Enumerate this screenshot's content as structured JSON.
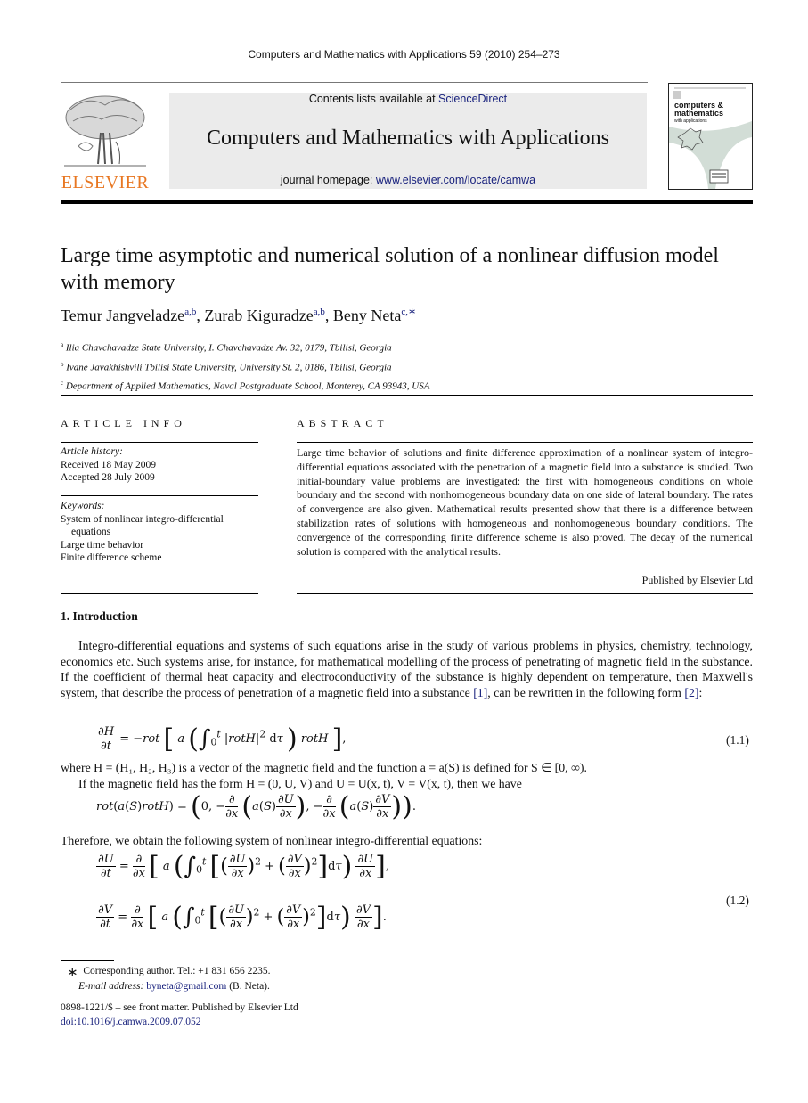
{
  "running_head": "Computers and Mathematics with Applications 59 (2010) 254–273",
  "masthead": {
    "publisher": "ELSEVIER",
    "contents_prefix": "Contents lists available at ",
    "contents_link": "ScienceDirect",
    "journal_title": "Computers and Mathematics with Applications",
    "homepage_prefix": "journal homepage: ",
    "homepage_link": "www.elsevier.com/locate/camwa",
    "cover_title_line1": "computers &",
    "cover_title_line2": "mathematics",
    "cover_subtitle": "with applications",
    "colors": {
      "publisher_orange": "#e87722",
      "link_blue": "#1a237e",
      "masthead_gray": "#ebebeb"
    }
  },
  "paper": {
    "title": "Large time asymptotic and numerical solution of a nonlinear diffusion model with memory",
    "authors": [
      {
        "name": "Temur Jangveladze",
        "marks": "a,b"
      },
      {
        "name": "Zurab Kiguradze",
        "marks": "a,b"
      },
      {
        "name": "Beny Neta",
        "marks": "c,∗"
      }
    ],
    "affiliations": [
      {
        "mark": "a",
        "text": "Ilia Chavchavadze State University, I. Chavchavadze Av. 32, 0179, Tbilisi, Georgia"
      },
      {
        "mark": "b",
        "text": "Ivane Javakhishvili Tbilisi State University, University St. 2, 0186, Tbilisi, Georgia"
      },
      {
        "mark": "c",
        "text": "Department of Applied Mathematics, Naval Postgraduate School, Monterey, CA 93943, USA"
      }
    ]
  },
  "article_info": {
    "heading": "ARTICLE INFO",
    "history_label": "Article history:",
    "received": "Received 18 May 2009",
    "accepted": "Accepted 28 July 2009",
    "keywords_label": "Keywords:",
    "keywords": [
      "System of nonlinear integro-differential",
      "equations",
      "Large time behavior",
      "Finite difference scheme"
    ]
  },
  "abstract": {
    "heading": "ABSTRACT",
    "text": "Large time behavior of solutions and finite difference approximation of a nonlinear system of integro-differential equations associated with the penetration of a magnetic field into a substance is studied. Two initial-boundary value problems are investigated: the first with homogeneous conditions on whole boundary and the second with nonhomogeneous boundary data on one side of lateral boundary. The rates of convergence are also given. Mathematical results presented show that there is a difference between stabilization rates of solutions with homogeneous and nonhomogeneous boundary conditions. The convergence of the corresponding finite difference scheme is also proved. The decay of the numerical solution is compared with the analytical results.",
    "published_by": "Published by Elsevier Ltd"
  },
  "introduction": {
    "heading": "1.  Introduction",
    "para1_before_ref1": "Integro-differential equations and systems of such equations arise in the study of various problems in physics, chemistry, technology, economics etc. Such systems arise, for instance, for mathematical modelling of the process of penetrating of magnetic field in the substance. If the coefficient of thermal heat capacity and electroconductivity of the substance is highly dependent on temperature, then Maxwell's system, that describe the process of penetration of a magnetic field into a substance ",
    "ref1": "[1]",
    "para1_between": ", can be rewritten in the following form ",
    "ref2": "[2]",
    "para1_end": ":",
    "eq11_number": "(1.1)",
    "where_line": "where H = (H₁, H₂, H₃) is a vector of the magnetic field and the function a = a(S) is defined for S ∈ [0, ∞).",
    "if_line": "If the magnetic field has the form H = (0, U, V) and U = U(x, t), V = V(x, t), then we have",
    "therefore_line": "Therefore, we obtain the following system of nonlinear integro-differential equations:",
    "eq12_number": "(1.2)"
  },
  "footnote": {
    "star": "∗",
    "corresponding": "Corresponding author. Tel.: +1 831 656 2235.",
    "email_label": "E-mail address: ",
    "email": "byneta@gmail.com",
    "email_suffix": " (B. Neta)."
  },
  "issn": {
    "line": "0898-1221/$ – see front matter.  Published by Elsevier Ltd",
    "doi": "doi:10.1016/j.camwa.2009.07.052"
  }
}
